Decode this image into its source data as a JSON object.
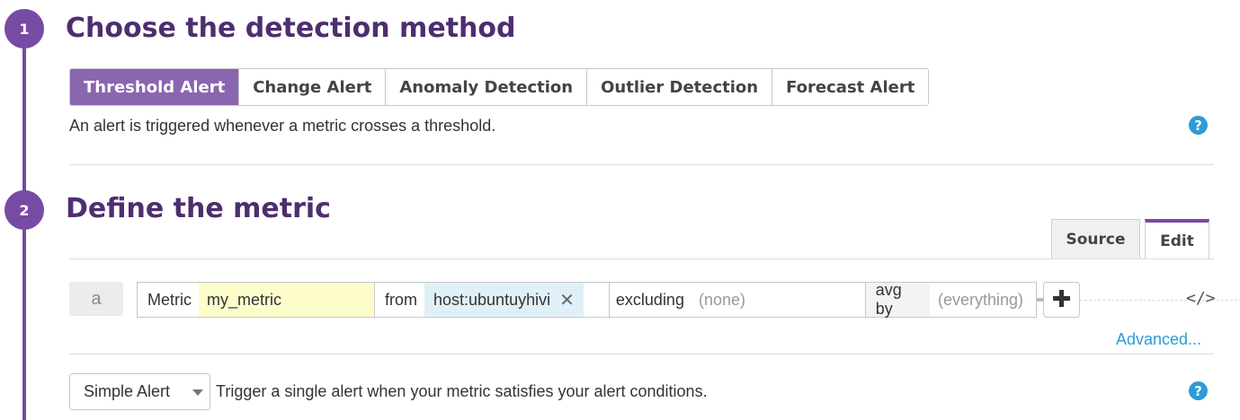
{
  "step1": {
    "number": "1",
    "title": "Choose the detection method"
  },
  "methods": [
    {
      "label": "Threshold Alert",
      "active": true
    },
    {
      "label": "Change Alert",
      "active": false
    },
    {
      "label": "Anomaly Detection",
      "active": false
    },
    {
      "label": "Outlier Detection",
      "active": false
    },
    {
      "label": "Forecast Alert",
      "active": false
    }
  ],
  "method_description": "An alert is triggered whenever a metric crosses a threshold.",
  "help_icon": "?",
  "step2": {
    "number": "2",
    "title": "Define the metric"
  },
  "view_tabs": {
    "source": "Source",
    "edit": "Edit",
    "active": "Edit"
  },
  "query": {
    "label": "a",
    "metric_label": "Metric",
    "metric_value": "my_metric",
    "from_label": "from",
    "from_value": "host:ubuntuyhivi",
    "from_remove": "✕",
    "excluding_label": "excluding",
    "excluding_placeholder": "(none)",
    "avgby_label": "avg by",
    "avgby_placeholder": "(everything)",
    "add_symbol": "✚",
    "code_symbol": "</>"
  },
  "advanced_link": "Advanced...",
  "alert_type": {
    "selected": "Simple Alert",
    "description": "Trigger a single alert when your metric satisfies your alert conditions."
  },
  "colors": {
    "accent": "#774aa4",
    "active_tab": "#8a65b0",
    "link": "#2d9bd6",
    "metric_bg": "#fdfdcb",
    "tag_bg": "#dff0f9"
  }
}
